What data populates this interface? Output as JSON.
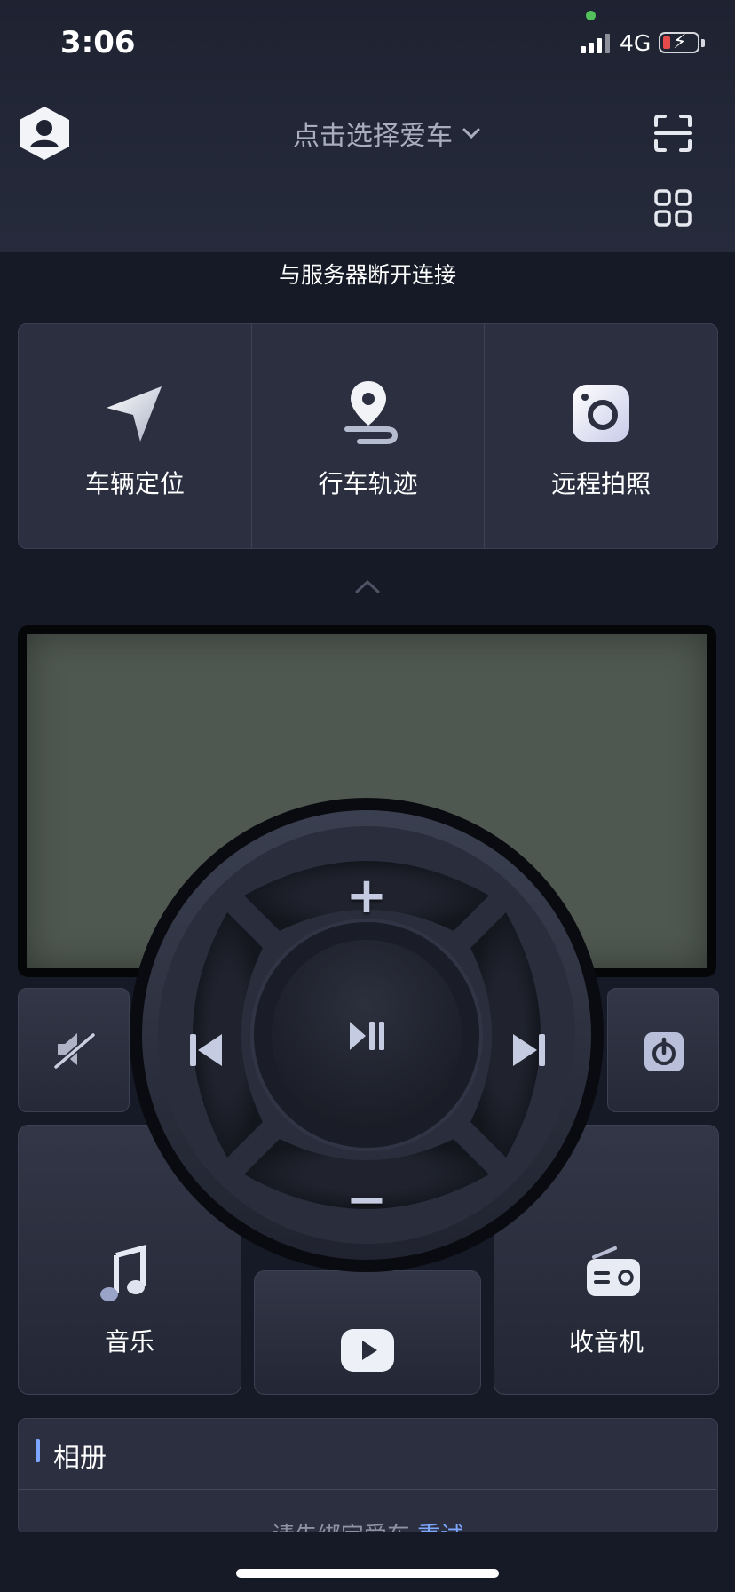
{
  "status_bar": {
    "time": "3:06",
    "network": "4G"
  },
  "header": {
    "car_select_label": "点击选择爱车"
  },
  "banner": {
    "message": "与服务器断开连接"
  },
  "features": [
    {
      "label": "车辆定位",
      "icon": "navigation-arrow-icon"
    },
    {
      "label": "行车轨迹",
      "icon": "route-pin-icon"
    },
    {
      "label": "远程拍照",
      "icon": "camera-icon"
    }
  ],
  "remote": {
    "vol_up": "+",
    "vol_down": "−",
    "music_label": "音乐",
    "radio_label": "收音机"
  },
  "album": {
    "title": "相册",
    "hint_text": "请先绑定爱车,",
    "hint_link": "重试"
  },
  "colors": {
    "accent": "#7da6ff",
    "background": "#161a26",
    "card": "#2b2f40",
    "lcd": "#4e5750",
    "status_green": "#53c15b",
    "battery_low": "#e54b4b"
  }
}
